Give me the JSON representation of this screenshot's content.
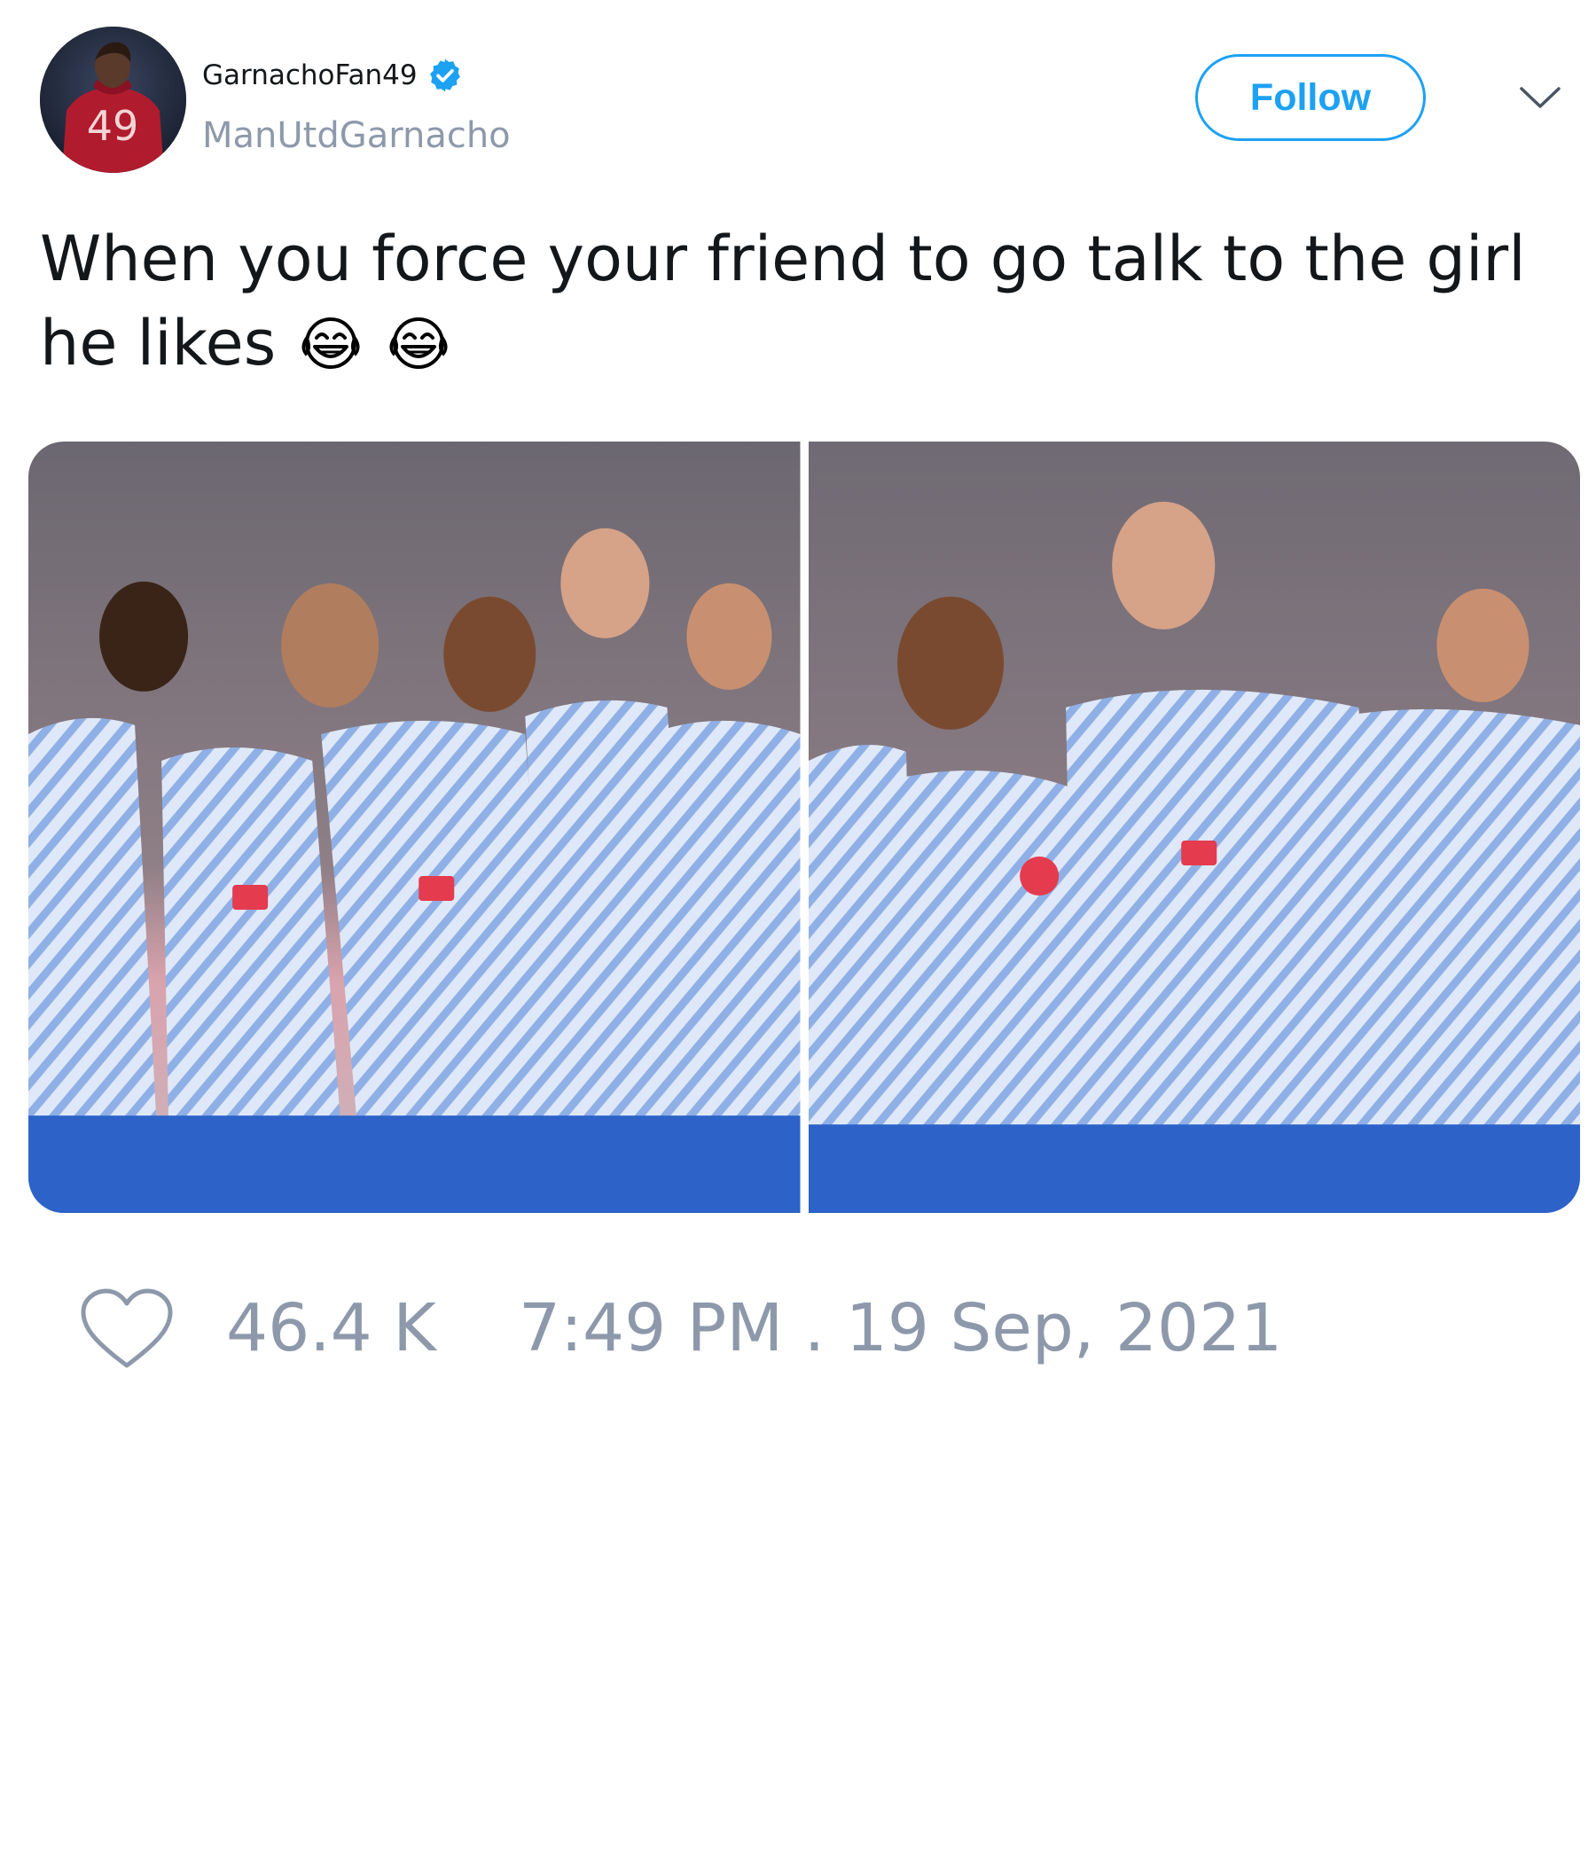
{
  "author": {
    "display_name": "GarnachoFan49",
    "handle": "ManUtdGarnacho",
    "avatar_number": "49",
    "verified": true
  },
  "follow_label": "Follow",
  "tweet": {
    "text": "When you force your friend to go talk to the girl he likes",
    "emojis": [
      "face-with-tears-of-joy",
      "face-with-tears-of-joy"
    ]
  },
  "media": {
    "count": 2,
    "photos": [
      {
        "name": "team-celebration-photo-1"
      },
      {
        "name": "team-celebration-photo-2"
      }
    ]
  },
  "footer": {
    "like_icon": "heart-icon",
    "likes": "46.4 K",
    "timestamp": "7:49 PM . 19 Sep, 2021"
  },
  "colors": {
    "accent": "#1da1f2",
    "muted": "#8d99ab",
    "text": "#14171a"
  }
}
